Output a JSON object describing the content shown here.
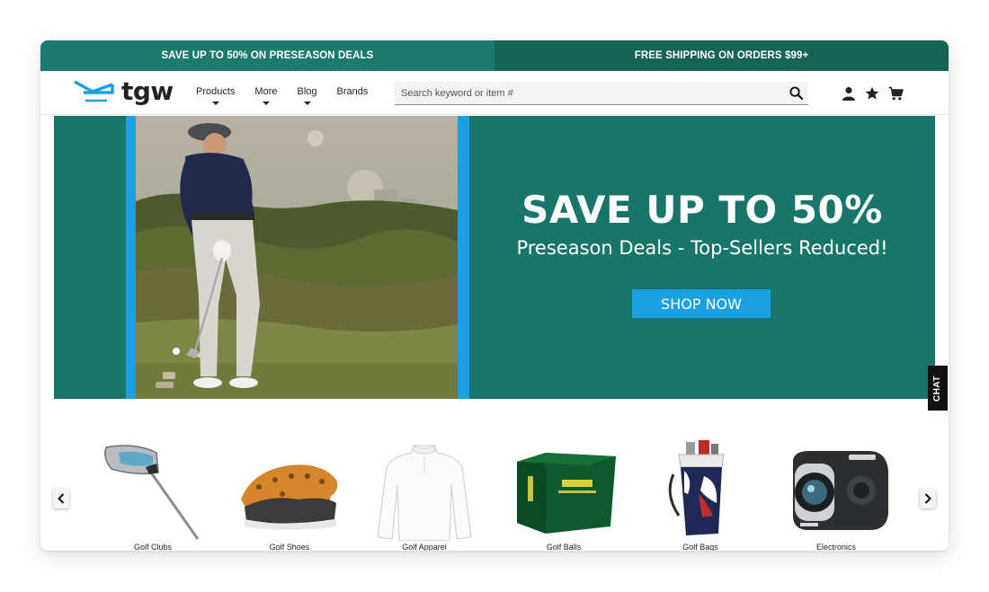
{
  "promo_bar": {
    "left_text": "SAVE UP TO 50% ON PRESEASON DEALS",
    "right_text": "FREE SHIPPING ON ORDERS $99+"
  },
  "header": {
    "logo_text": "tgw",
    "menu": [
      {
        "label": "Products",
        "has_caret": true
      },
      {
        "label": "More",
        "has_caret": true
      },
      {
        "label": "Blog",
        "has_caret": true
      },
      {
        "label": "Brands",
        "has_caret": false
      }
    ],
    "search": {
      "placeholder": "Search keyword or item #",
      "value": ""
    },
    "icons": [
      "user-icon",
      "star-icon",
      "cart-icon"
    ]
  },
  "hero": {
    "title": "SAVE UP TO 50%",
    "subtitle": "Preseason Deals - Top-Sellers Reduced!",
    "cta_label": "SHOP NOW"
  },
  "chat": {
    "label": "CHAT"
  },
  "categories": [
    {
      "label": "Golf Clubs"
    },
    {
      "label": "Golf Shoes"
    },
    {
      "label": "Golf Apparel"
    },
    {
      "label": "Golf Balls"
    },
    {
      "label": "Golf Bags"
    },
    {
      "label": "Electronics"
    }
  ],
  "colors": {
    "brand_teal": "#17756a",
    "promo_left": "#1b7a6c",
    "promo_right": "#166357",
    "accent_blue": "#1ba0e3"
  }
}
